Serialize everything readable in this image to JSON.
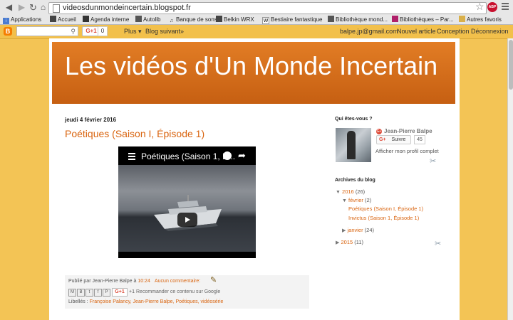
{
  "browser": {
    "url": "videosdunmondeincertain.blogspot.fr",
    "abp_label": "ABP",
    "bookmarks": [
      {
        "label": "Applications",
        "icon": "apps-grid-icon"
      },
      {
        "label": "Accueil",
        "icon": "bookmark-icon"
      },
      {
        "label": "Agenda interne",
        "icon": "bookmark-icon"
      },
      {
        "label": "Autolib",
        "icon": "bookmark-icon"
      },
      {
        "label": "Banque de sons",
        "icon": "music-note-icon"
      },
      {
        "label": "Belkin WRX",
        "icon": "bookmark-icon"
      },
      {
        "label": "Bestiaire fantastique",
        "icon": "wikipedia-icon"
      },
      {
        "label": "Bibliothèque mond...",
        "icon": "bookmark-icon"
      },
      {
        "label": "Bibliothèques – Par...",
        "icon": "bookmark-icon"
      },
      {
        "label": "Autres favoris",
        "icon": "folder-icon"
      }
    ]
  },
  "navbar": {
    "gplus_label": "G+1",
    "gplus_count": "0",
    "more_label": "Plus ▾",
    "next_blog": "Blog suivant»",
    "email": "balpe.jp@gmail.com",
    "new_post": "Nouvel article",
    "design": "Conception",
    "logout": "Déconnexion"
  },
  "blog": {
    "title": "Les vidéos d'Un Monde Incertain"
  },
  "post": {
    "date": "jeudi 4 février 2016",
    "title": "Poétiques (Saison I, Épisode 1)",
    "video_title": "Poétiques (Saison 1, É...",
    "footer": {
      "published_by": "Publié par",
      "author": "Jean-Pierre Balpe",
      "at": "à",
      "time": "10:24",
      "comments": "Aucun commentaire:",
      "gplus": "G+1",
      "plus_one": "+1",
      "recommend": "Recommander ce contenu sur Google",
      "labels_prefix": "Libellés :",
      "labels": "Françoise Palancy, Jean-Pierre Balpe, Poétiques, vidéosérie",
      "share_icons": [
        "M",
        "B",
        "t",
        "f",
        "P"
      ]
    }
  },
  "sidebar": {
    "about_heading": "Qui êtes-vous ?",
    "profile_name": "Jean-Pierre Balpe",
    "follow_label": "Suivre",
    "follow_count": "45",
    "view_profile": "Afficher mon profil complet",
    "archive_heading": "Archives du blog",
    "archive": {
      "y2016": "2016",
      "y2016_count": "(26)",
      "feb": "février",
      "feb_count": "(2)",
      "post1": "Poétiques (Saison I, Épisode 1)",
      "post2": "Invictus (Saison 1, Épisode 1)",
      "jan": "janvier",
      "jan_count": "(24)",
      "y2015": "2015",
      "y2015_count": "(11)"
    }
  },
  "colors": {
    "background": "#f3c455",
    "header": "#d36a18",
    "link": "#d9640f"
  }
}
